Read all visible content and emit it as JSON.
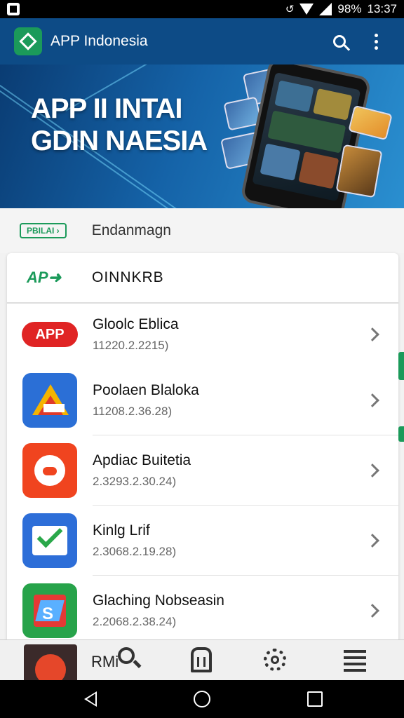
{
  "status_bar": {
    "battery": "98%",
    "time": "13:37"
  },
  "app_bar": {
    "title": "APP Indonesia"
  },
  "banner": {
    "line1": "APP II INTAI",
    "line2": "GDIN NAESIA"
  },
  "category": {
    "badge": "PBILAI",
    "label": "Endanmagn"
  },
  "card": {
    "brand": "AP",
    "heading": "OINNKRB",
    "items": [
      {
        "name": "Gloolc Eblica",
        "meta": "11220.2.2215)",
        "icon": "app-pill-icon",
        "icon_label": "APP",
        "color": "#e02424"
      },
      {
        "name": "Poolaen Blaloka",
        "meta": "11208.2.36.28)",
        "icon": "drive-triangle-icon",
        "color": "#2b6fd6"
      },
      {
        "name": "Apdiac Buitetia",
        "meta": "2.3293.2.30.24)",
        "icon": "pig-face-icon",
        "color": "#f0441f"
      },
      {
        "name": "Kinlg Lrif",
        "meta": "2.3068.2.19.28)",
        "icon": "check-envelope-icon",
        "color": "#2d6ed8"
      },
      {
        "name": "Glaching Nobseasin",
        "meta": "2.2068.2.38.24)",
        "icon": "shield-s-icon",
        "color": "#27a34a"
      }
    ]
  },
  "bottom_nav": {
    "label": "RMi"
  },
  "colors": {
    "primary": "#0d4b86",
    "accent": "#1b9a5a",
    "danger": "#e02424"
  }
}
